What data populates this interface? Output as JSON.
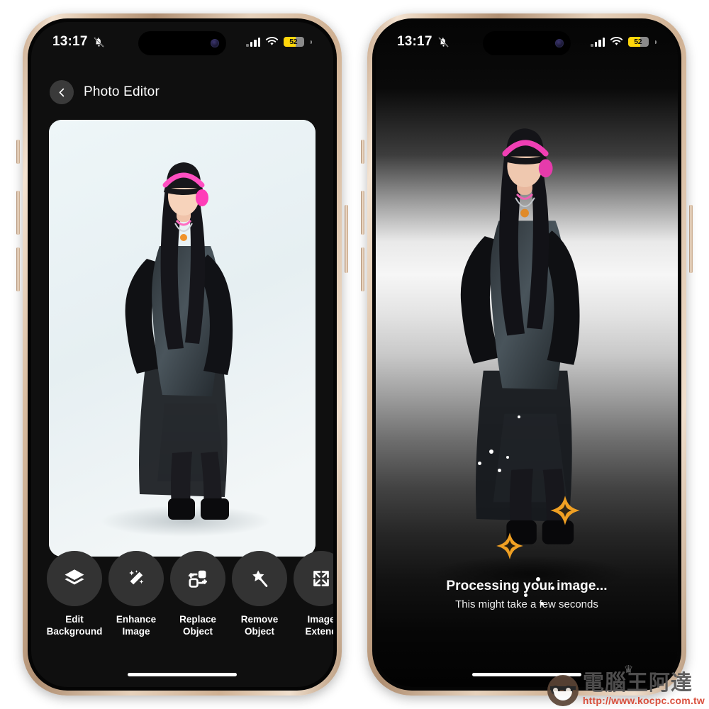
{
  "status_bar": {
    "time": "13:17",
    "mute_icon": "bell-slash-icon",
    "signal_icon": "cellular-bars-icon",
    "wifi_icon": "wifi-icon",
    "battery_level": "52",
    "battery_color": "#ffd60a",
    "battery_track_color": "#8a8a8a"
  },
  "left_phone": {
    "header": {
      "back_icon": "chevron-left-icon",
      "title": "Photo Editor"
    },
    "photo": {
      "alt": "Model wearing black cap with pink headphones, black fringe cardigan, plaid slip dress and tall black boots on pale blue backdrop",
      "background_color": "#eaf3f5"
    },
    "toolbar": [
      {
        "icon": "layers-icon",
        "label": "Edit\nBackground"
      },
      {
        "icon": "magic-wand-sparkle-icon",
        "label": "Enhance\nImage"
      },
      {
        "icon": "replace-object-icon",
        "label": "Replace\nObject"
      },
      {
        "icon": "star-wand-icon",
        "label": "Remove\nObject"
      },
      {
        "icon": "expand-arrows-icon",
        "label": "Image\nExtend"
      }
    ]
  },
  "right_phone": {
    "processing": {
      "title": "Processing your image...",
      "subtitle": "This might take a few seconds",
      "sparkle_color": "#f0a023",
      "sparkle_icon": "four-point-star-icon",
      "dot_color": "#ffffff"
    },
    "background": {
      "description": "AI generated studio gradient backdrop: black top, bright silver horizon band, dark floor",
      "top_color": "#050505",
      "horizon_color": "#f6f6f6",
      "bottom_color": "#020202"
    }
  },
  "watermark": {
    "site_name": "電腦王阿達",
    "url": "http://www.kocpc.com.tw",
    "crown_icon": "crown-icon",
    "url_color": "#d7432f"
  }
}
